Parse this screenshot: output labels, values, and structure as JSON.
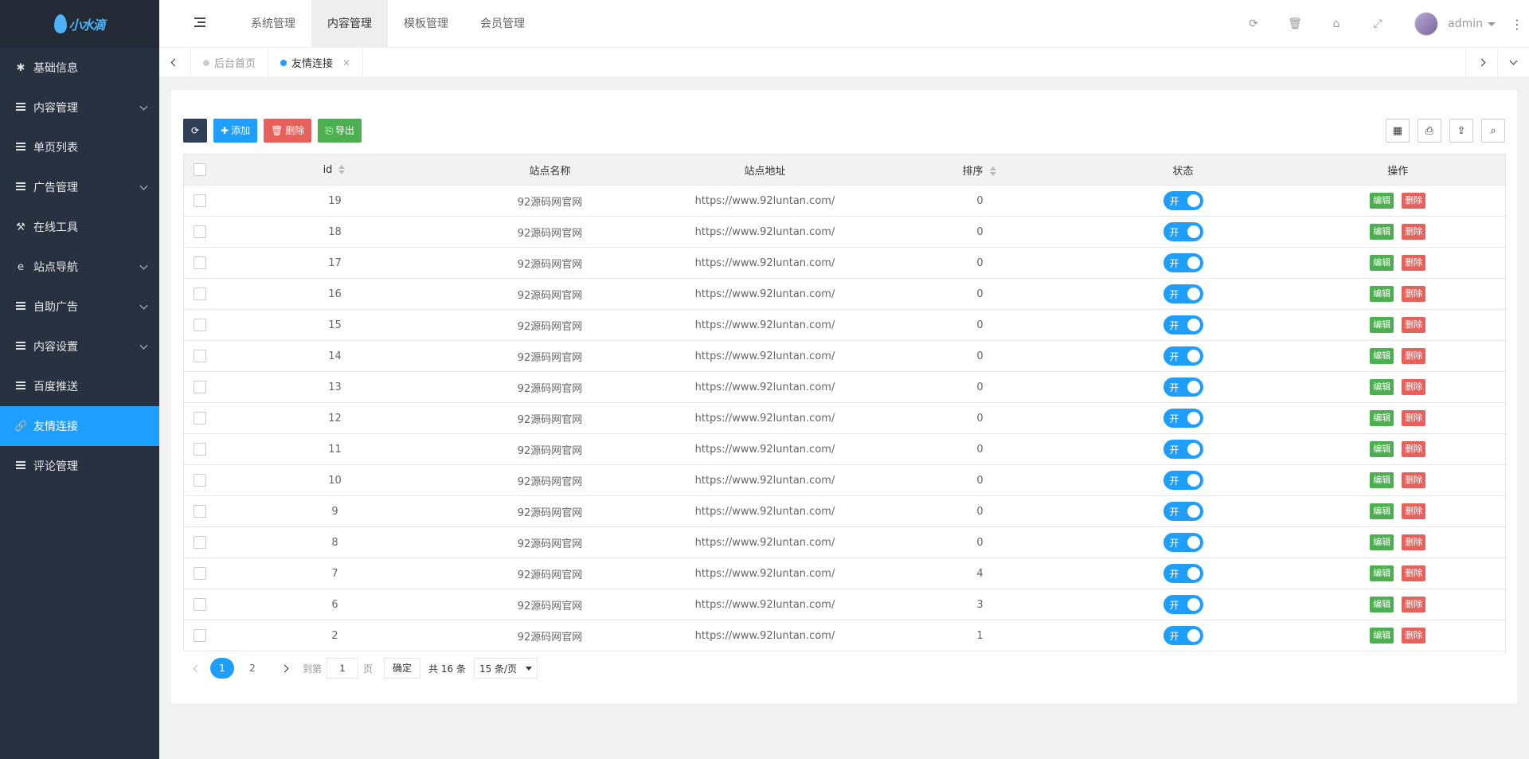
{
  "logo": {
    "text": "小水滴"
  },
  "sidebar": {
    "items": [
      {
        "label": "基础信息",
        "icon": "asterisk-icon",
        "glyph": "✱",
        "expandable": false,
        "active": false
      },
      {
        "label": "内容管理",
        "icon": "list-icon",
        "glyph": "",
        "expandable": true,
        "active": false
      },
      {
        "label": "单页列表",
        "icon": "list-icon",
        "glyph": "",
        "expandable": false,
        "active": false
      },
      {
        "label": "广告管理",
        "icon": "list-icon",
        "glyph": "",
        "expandable": true,
        "active": false
      },
      {
        "label": "在线工具",
        "icon": "hammer-icon",
        "glyph": "⚒",
        "expandable": false,
        "active": false
      },
      {
        "label": "站点导航",
        "icon": "ie-icon",
        "glyph": "e",
        "expandable": true,
        "active": false
      },
      {
        "label": "自助广告",
        "icon": "list-icon",
        "glyph": "",
        "expandable": true,
        "active": false
      },
      {
        "label": "内容设置",
        "icon": "list-icon",
        "glyph": "",
        "expandable": true,
        "active": false
      },
      {
        "label": "百度推送",
        "icon": "list-icon",
        "glyph": "",
        "expandable": false,
        "active": false
      },
      {
        "label": "友情连接",
        "icon": "link-icon",
        "glyph": "🔗",
        "expandable": false,
        "active": true
      },
      {
        "label": "评论管理",
        "icon": "list-icon",
        "glyph": "",
        "expandable": false,
        "active": false
      }
    ]
  },
  "header": {
    "nav": [
      "系统管理",
      "内容管理",
      "模板管理",
      "会员管理"
    ],
    "active_nav": 1,
    "right_icons": [
      "refresh-icon",
      "trash-icon",
      "home-icon",
      "fullscreen-icon"
    ],
    "user": "admin"
  },
  "tabs": [
    {
      "label": "后台首页",
      "active": false,
      "closable": false
    },
    {
      "label": "友情连接",
      "active": true,
      "closable": true
    }
  ],
  "toolbar": {
    "refresh_icon": "refresh-icon",
    "add_label": "添加",
    "delete_label": "删除",
    "export_label": "导出",
    "right_tools": [
      "columns-icon",
      "print-icon",
      "export-icon",
      "search-icon"
    ]
  },
  "table": {
    "columns": [
      "id",
      "站点名称",
      "站点地址",
      "排序",
      "状态",
      "操作"
    ],
    "switch_on_label": "开",
    "edit_label": "编辑",
    "delete_label": "删除",
    "rows": [
      {
        "id": "19",
        "name": "92源码网官网",
        "url": "https://www.92luntan.com/",
        "sort": "0"
      },
      {
        "id": "18",
        "name": "92源码网官网",
        "url": "https://www.92luntan.com/",
        "sort": "0"
      },
      {
        "id": "17",
        "name": "92源码网官网",
        "url": "https://www.92luntan.com/",
        "sort": "0"
      },
      {
        "id": "16",
        "name": "92源码网官网",
        "url": "https://www.92luntan.com/",
        "sort": "0"
      },
      {
        "id": "15",
        "name": "92源码网官网",
        "url": "https://www.92luntan.com/",
        "sort": "0"
      },
      {
        "id": "14",
        "name": "92源码网官网",
        "url": "https://www.92luntan.com/",
        "sort": "0"
      },
      {
        "id": "13",
        "name": "92源码网官网",
        "url": "https://www.92luntan.com/",
        "sort": "0"
      },
      {
        "id": "12",
        "name": "92源码网官网",
        "url": "https://www.92luntan.com/",
        "sort": "0"
      },
      {
        "id": "11",
        "name": "92源码网官网",
        "url": "https://www.92luntan.com/",
        "sort": "0"
      },
      {
        "id": "10",
        "name": "92源码网官网",
        "url": "https://www.92luntan.com/",
        "sort": "0"
      },
      {
        "id": "9",
        "name": "92源码网官网",
        "url": "https://www.92luntan.com/",
        "sort": "0"
      },
      {
        "id": "8",
        "name": "92源码网官网",
        "url": "https://www.92luntan.com/",
        "sort": "0"
      },
      {
        "id": "7",
        "name": "92源码网官网",
        "url": "https://www.92luntan.com/",
        "sort": "4"
      },
      {
        "id": "6",
        "name": "92源码网官网",
        "url": "https://www.92luntan.com/",
        "sort": "3"
      },
      {
        "id": "2",
        "name": "92源码网官网",
        "url": "https://www.92luntan.com/",
        "sort": "1"
      }
    ]
  },
  "pager": {
    "pages": [
      "1",
      "2"
    ],
    "current": "1",
    "goto_label": "到第",
    "goto_value": "1",
    "page_unit": "页",
    "confirm_label": "确定",
    "total_label": "共 16 条",
    "per_page_label": "15 条/页"
  },
  "colors": {
    "sidebar_bg": "#28313f",
    "accent": "#1e9fff",
    "edit": "#4caf50",
    "delete": "#e8605a"
  }
}
